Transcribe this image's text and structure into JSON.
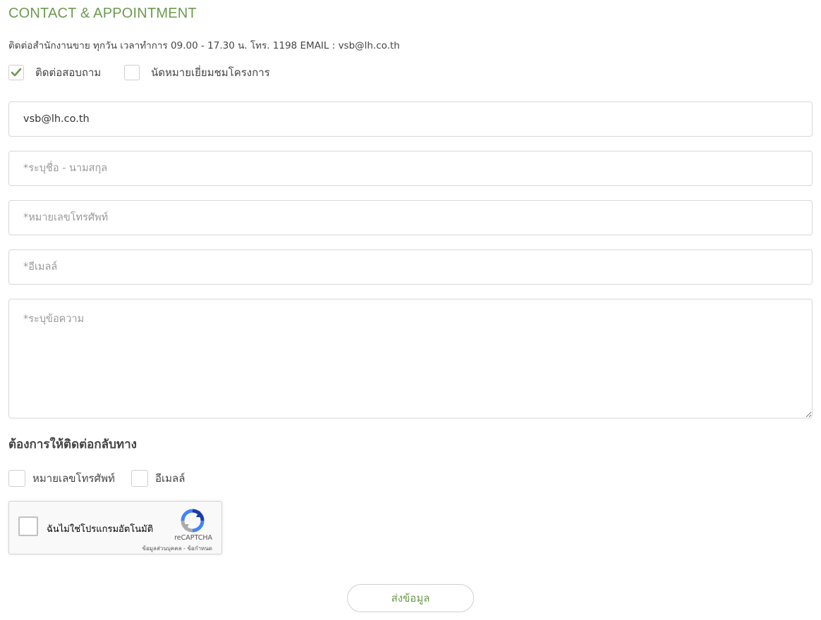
{
  "header": {
    "title": "CONTACT & APPOINTMENT",
    "info": "ติดต่อสำนักงานขาย ทุกวัน เวลาทำการ 09.00 - 17.30 น. โทร. 1198 EMAIL : vsb@lh.co.th"
  },
  "type_options": [
    {
      "label": "ติดต่อสอบถาม",
      "checked": true
    },
    {
      "label": "นัดหมายเยี่ยมชมโครงการ",
      "checked": false
    }
  ],
  "form": {
    "project_email": {
      "value": "vsb@lh.co.th",
      "placeholder": ""
    },
    "name": {
      "value": "",
      "placeholder": "*ระบุชื่อ - นามสกุล"
    },
    "phone": {
      "value": "",
      "placeholder": "*หมายเลขโทรศัพท์"
    },
    "email": {
      "value": "",
      "placeholder": "*อีเมลล์"
    },
    "message": {
      "value": "",
      "placeholder": "*ระบุข้อความ"
    }
  },
  "callback": {
    "heading": "ต้องการให้ติดต่อกลับทาง",
    "options": [
      {
        "label": "หมายเลขโทรศัพท์",
        "checked": false
      },
      {
        "label": "อีเมลล์",
        "checked": false
      }
    ]
  },
  "recaptcha": {
    "label": "ฉันไม่ใช่โปรแกรมอัตโนมัติ",
    "brand": "reCAPTCHA",
    "terms": "ข้อมูลส่วนบุคคล - ข้อกำหนด",
    "checked": false
  },
  "submit": {
    "label": "ส่งข้อมูล"
  },
  "colors": {
    "accent": "#6d9a4f",
    "border": "#d8d8d8"
  },
  "icons": {
    "check": "check-icon",
    "recaptcha": "recaptcha-logo-icon"
  }
}
